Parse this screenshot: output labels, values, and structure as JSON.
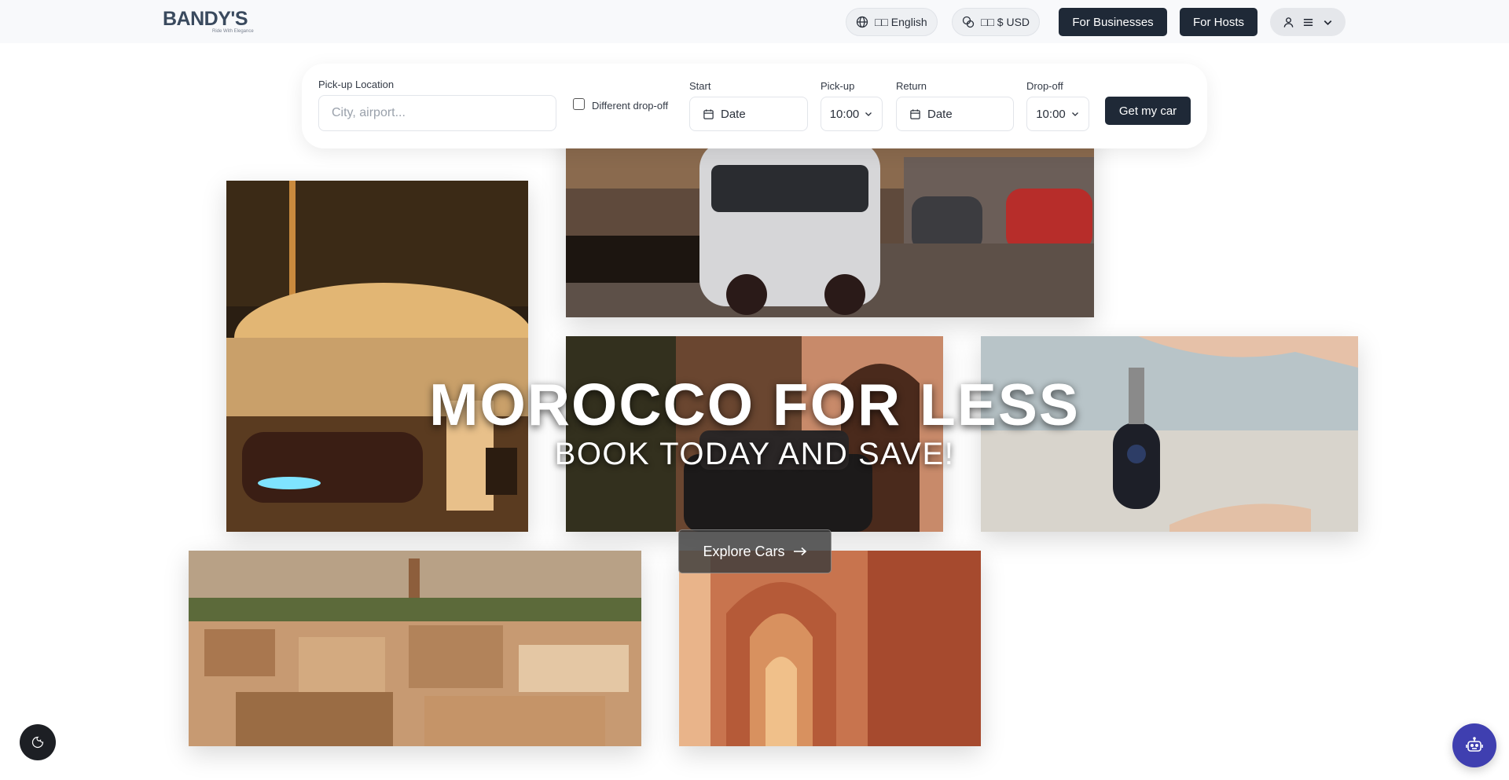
{
  "header": {
    "logo_text": "BANDY'S",
    "logo_tagline": "Ride With Elegance",
    "language_label": "□□ English",
    "currency_label": "□□ $ USD",
    "for_businesses": "For Businesses",
    "for_hosts": "For Hosts",
    "icons": [
      "globe-icon",
      "currency-icon",
      "user-icon",
      "menu-icon",
      "chevron-down-icon"
    ]
  },
  "search": {
    "pickup_location_label": "Pick-up Location",
    "pickup_location_placeholder": "City, airport...",
    "different_dropoff_label": "Different drop-off",
    "different_dropoff_checked": false,
    "start_label": "Start",
    "start_value": "Date",
    "pickup_label": "Pick-up",
    "pickup_time": "10:00",
    "return_label": "Return",
    "return_value": "Date",
    "dropoff_label": "Drop-off",
    "dropoff_time": "10:00",
    "submit_label": "Get my car"
  },
  "hero": {
    "title": "MOROCCO FOR LESS",
    "subtitle": "BOOK TODAY AND SAVE!",
    "cta_label": "Explore Cars"
  },
  "colors": {
    "primary_dark": "#1f2937",
    "chat_button": "#3f3fb0",
    "header_bg": "#f8f9fb"
  }
}
